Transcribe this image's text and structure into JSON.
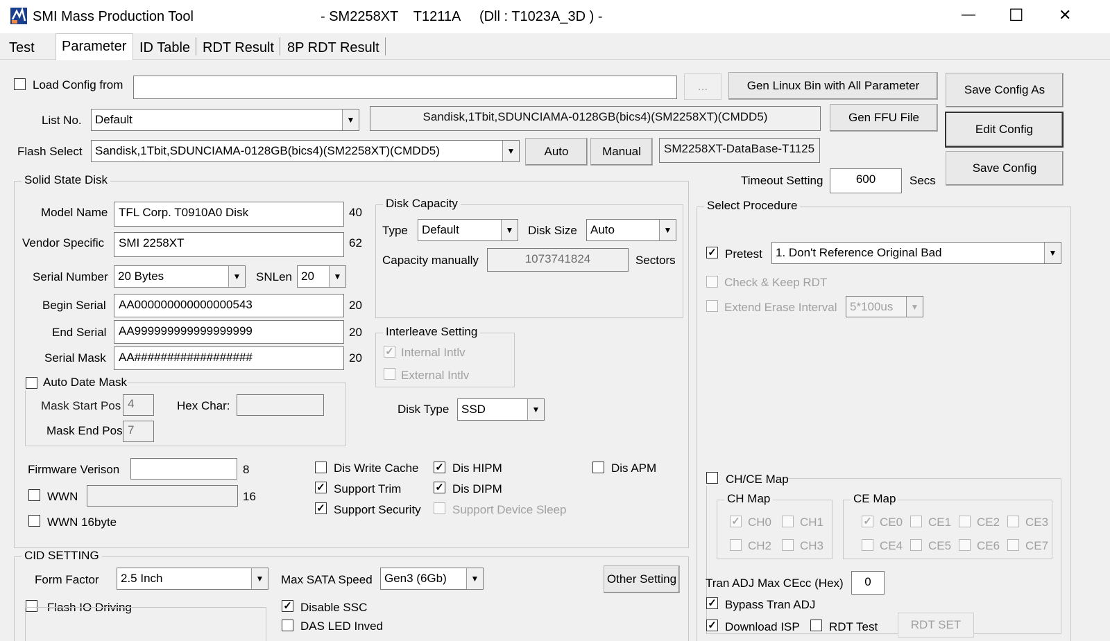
{
  "window": {
    "title": "SMI Mass Production Tool",
    "subtitle": "- SM2258XT    T1211A     (Dll : T1023A_3D ) -",
    "minimize": "—",
    "maximize": "☐",
    "close": "✕"
  },
  "tabs": [
    "Test",
    "Parameter",
    "ID Table",
    "RDT Result",
    "8P RDT Result"
  ],
  "top": {
    "load_config": "Load Config from",
    "load_path": "",
    "browse": "...",
    "gen_linux": "Gen Linux Bin with All Parameter",
    "save_config_as": "Save Config As",
    "list_no_label": "List No.",
    "list_no_value": "Default",
    "flash_info": "Sandisk,1Tbit,SDUNCIAMA-0128GB(bics4)(SM2258XT)(CMDD5)",
    "gen_ffu": "Gen FFU File",
    "edit_config": "Edit Config",
    "flash_select_label": "Flash Select",
    "flash_select_value": "Sandisk,1Tbit,SDUNCIAMA-0128GB(bics4)(SM2258XT)(CMDD5)",
    "auto": "Auto",
    "manual": "Manual",
    "database": "SM2258XT-DataBase-T1125",
    "save_config": "Save Config",
    "timeout_label": "Timeout Setting",
    "timeout_value": "600",
    "timeout_unit": "Secs"
  },
  "ssd": {
    "title": "Solid State Disk",
    "model_name_label": "Model Name",
    "model_name": "TFL Corp. T0910A0 Disk",
    "model_len": "40",
    "vendor_label": "Vendor Specific",
    "vendor": "SMI 2258XT",
    "vendor_len": "62",
    "serial_label": "Serial Number",
    "serial": "20 Bytes",
    "snlen_label": "SNLen",
    "snlen": "20",
    "begin_label": "Begin Serial",
    "begin": "AA000000000000000543",
    "begin_len": "20",
    "end_label": "End Serial",
    "end": "AA999999999999999999",
    "end_len": "20",
    "mask_label": "Serial Mask",
    "mask": "AA##################",
    "mask_len": "20",
    "auto_date": "Auto Date Mask",
    "mask_start_label": "Mask Start Pos",
    "mask_start": "4",
    "hex_char_label": "Hex Char:",
    "hex_char": "",
    "mask_end_label": "Mask End Pos",
    "mask_end": "7",
    "fw_label": "Firmware Verison",
    "fw": "",
    "fw_len": "8",
    "wwn": "WWN",
    "wwn_value": "",
    "wwn_len": "16",
    "wwn16": "WWN 16byte"
  },
  "disk_capacity": {
    "title": "Disk Capacity",
    "type_label": "Type",
    "type": "Default",
    "size_label": "Disk Size",
    "size": "Auto",
    "cap_label": "Capacity manually",
    "cap": "1073741824",
    "cap_unit": "Sectors"
  },
  "interleave": {
    "title": "Interleave Setting",
    "internal": "Internal Intlv",
    "external": "External Intlv"
  },
  "disk_type": {
    "label": "Disk Type",
    "value": "SSD"
  },
  "features": {
    "dis_write_cache": "Dis Write Cache",
    "dis_hipm": "Dis HIPM",
    "dis_apm": "Dis APM",
    "support_trim": "Support Trim",
    "dis_dipm": "Dis DIPM",
    "support_security": "Support Security",
    "support_sleep": "Support Device Sleep"
  },
  "cid": {
    "title": "CID SETTING",
    "form_label": "Form Factor",
    "form": "2.5 Inch",
    "sata_label": "Max SATA Speed",
    "sata": "Gen3 (6Gb)",
    "other": "Other Setting",
    "flash_io": "Flash IO Driving",
    "disable_ssc": "Disable SSC",
    "das_led": "DAS LED Inved"
  },
  "procedure": {
    "title": "Select Procedure",
    "pretest": "Pretest",
    "pretest_value": "1. Don't Reference Original Bad",
    "check_keep": "Check & Keep RDT",
    "extend_erase": "Extend Erase Interval",
    "extend_value": "5*100us"
  },
  "chce": {
    "title": "CH/CE Map",
    "ch_title": "CH Map",
    "ce_title": "CE Map",
    "ch": [
      "CH0",
      "CH1",
      "CH2",
      "CH3"
    ],
    "ce": [
      "CE0",
      "CE1",
      "CE2",
      "CE3",
      "CE4",
      "CE5",
      "CE6",
      "CE7"
    ]
  },
  "tran": {
    "label": "Tran ADJ Max CEcc (Hex)",
    "value": "0",
    "bypass": "Bypass Tran ADJ",
    "download_isp": "Download ISP",
    "rdt_test": "RDT Test",
    "rdt_set": "RDT SET"
  }
}
